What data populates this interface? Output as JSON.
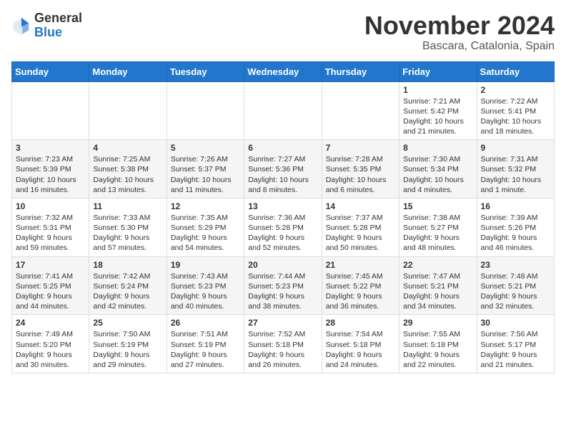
{
  "header": {
    "logo_general": "General",
    "logo_blue": "Blue",
    "month_title": "November 2024",
    "location": "Bascara, Catalonia, Spain"
  },
  "days_of_week": [
    "Sunday",
    "Monday",
    "Tuesday",
    "Wednesday",
    "Thursday",
    "Friday",
    "Saturday"
  ],
  "weeks": [
    [
      {
        "day": "",
        "info": ""
      },
      {
        "day": "",
        "info": ""
      },
      {
        "day": "",
        "info": ""
      },
      {
        "day": "",
        "info": ""
      },
      {
        "day": "",
        "info": ""
      },
      {
        "day": "1",
        "info": "Sunrise: 7:21 AM\nSunset: 5:42 PM\nDaylight: 10 hours and 21 minutes."
      },
      {
        "day": "2",
        "info": "Sunrise: 7:22 AM\nSunset: 5:41 PM\nDaylight: 10 hours and 18 minutes."
      }
    ],
    [
      {
        "day": "3",
        "info": "Sunrise: 7:23 AM\nSunset: 5:39 PM\nDaylight: 10 hours and 16 minutes."
      },
      {
        "day": "4",
        "info": "Sunrise: 7:25 AM\nSunset: 5:38 PM\nDaylight: 10 hours and 13 minutes."
      },
      {
        "day": "5",
        "info": "Sunrise: 7:26 AM\nSunset: 5:37 PM\nDaylight: 10 hours and 11 minutes."
      },
      {
        "day": "6",
        "info": "Sunrise: 7:27 AM\nSunset: 5:36 PM\nDaylight: 10 hours and 8 minutes."
      },
      {
        "day": "7",
        "info": "Sunrise: 7:28 AM\nSunset: 5:35 PM\nDaylight: 10 hours and 6 minutes."
      },
      {
        "day": "8",
        "info": "Sunrise: 7:30 AM\nSunset: 5:34 PM\nDaylight: 10 hours and 4 minutes."
      },
      {
        "day": "9",
        "info": "Sunrise: 7:31 AM\nSunset: 5:32 PM\nDaylight: 10 hours and 1 minute."
      }
    ],
    [
      {
        "day": "10",
        "info": "Sunrise: 7:32 AM\nSunset: 5:31 PM\nDaylight: 9 hours and 59 minutes."
      },
      {
        "day": "11",
        "info": "Sunrise: 7:33 AM\nSunset: 5:30 PM\nDaylight: 9 hours and 57 minutes."
      },
      {
        "day": "12",
        "info": "Sunrise: 7:35 AM\nSunset: 5:29 PM\nDaylight: 9 hours and 54 minutes."
      },
      {
        "day": "13",
        "info": "Sunrise: 7:36 AM\nSunset: 5:28 PM\nDaylight: 9 hours and 52 minutes."
      },
      {
        "day": "14",
        "info": "Sunrise: 7:37 AM\nSunset: 5:28 PM\nDaylight: 9 hours and 50 minutes."
      },
      {
        "day": "15",
        "info": "Sunrise: 7:38 AM\nSunset: 5:27 PM\nDaylight: 9 hours and 48 minutes."
      },
      {
        "day": "16",
        "info": "Sunrise: 7:39 AM\nSunset: 5:26 PM\nDaylight: 9 hours and 46 minutes."
      }
    ],
    [
      {
        "day": "17",
        "info": "Sunrise: 7:41 AM\nSunset: 5:25 PM\nDaylight: 9 hours and 44 minutes."
      },
      {
        "day": "18",
        "info": "Sunrise: 7:42 AM\nSunset: 5:24 PM\nDaylight: 9 hours and 42 minutes."
      },
      {
        "day": "19",
        "info": "Sunrise: 7:43 AM\nSunset: 5:23 PM\nDaylight: 9 hours and 40 minutes."
      },
      {
        "day": "20",
        "info": "Sunrise: 7:44 AM\nSunset: 5:23 PM\nDaylight: 9 hours and 38 minutes."
      },
      {
        "day": "21",
        "info": "Sunrise: 7:45 AM\nSunset: 5:22 PM\nDaylight: 9 hours and 36 minutes."
      },
      {
        "day": "22",
        "info": "Sunrise: 7:47 AM\nSunset: 5:21 PM\nDaylight: 9 hours and 34 minutes."
      },
      {
        "day": "23",
        "info": "Sunrise: 7:48 AM\nSunset: 5:21 PM\nDaylight: 9 hours and 32 minutes."
      }
    ],
    [
      {
        "day": "24",
        "info": "Sunrise: 7:49 AM\nSunset: 5:20 PM\nDaylight: 9 hours and 30 minutes."
      },
      {
        "day": "25",
        "info": "Sunrise: 7:50 AM\nSunset: 5:19 PM\nDaylight: 9 hours and 29 minutes."
      },
      {
        "day": "26",
        "info": "Sunrise: 7:51 AM\nSunset: 5:19 PM\nDaylight: 9 hours and 27 minutes."
      },
      {
        "day": "27",
        "info": "Sunrise: 7:52 AM\nSunset: 5:18 PM\nDaylight: 9 hours and 26 minutes."
      },
      {
        "day": "28",
        "info": "Sunrise: 7:54 AM\nSunset: 5:18 PM\nDaylight: 9 hours and 24 minutes."
      },
      {
        "day": "29",
        "info": "Sunrise: 7:55 AM\nSunset: 5:18 PM\nDaylight: 9 hours and 22 minutes."
      },
      {
        "day": "30",
        "info": "Sunrise: 7:56 AM\nSunset: 5:17 PM\nDaylight: 9 hours and 21 minutes."
      }
    ]
  ]
}
